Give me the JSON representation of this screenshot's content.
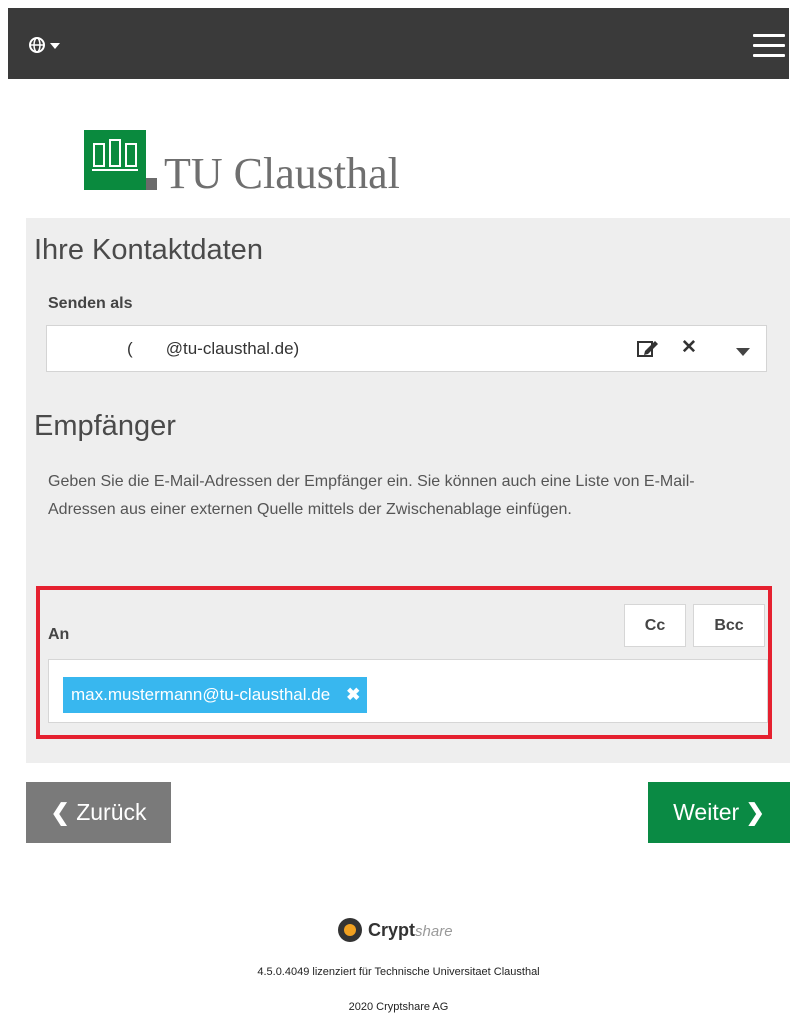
{
  "header": {
    "language_icon": "globe-icon",
    "menu_icon": "hamburger-menu-icon"
  },
  "logo": {
    "text": "TU Clausthal",
    "brand_color": "#0a8a3e"
  },
  "contact": {
    "title": "Ihre Kontaktdaten",
    "send_as_label": "Senden als",
    "sender_value": "(       @tu-clausthal.de)",
    "icons": [
      "edit-icon",
      "close-icon",
      "caret-down-icon"
    ]
  },
  "recipients": {
    "title": "Empfänger",
    "description": "Geben Sie die E-Mail-Adressen der Empfänger ein. Sie können auch eine Liste von E-Mail-Adressen aus einer externen Quelle mittels der Zwischenablage einfügen.",
    "to_label": "An",
    "cc_label": "Cc",
    "bcc_label": "Bcc",
    "chip_email": "max.mustermann@tu-clausthal.de",
    "chip_remove": "✖",
    "highlight_color": "#e5202f",
    "chip_color": "#38b7ef"
  },
  "nav": {
    "back_label": "Zurück",
    "next_label": "Weiter",
    "next_color": "#0a8a44"
  },
  "footer": {
    "brand_bold": "Crypt",
    "brand_light": "share",
    "license": "4.5.0.4049 lizenziert für Technische Universitaet Clausthal",
    "copyright": "2020 Cryptshare AG"
  }
}
